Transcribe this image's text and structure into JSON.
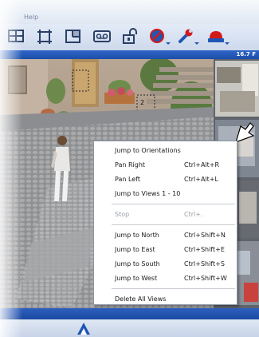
{
  "menubar": {
    "help_label": "Help"
  },
  "statusbar": {
    "fps_text": "16.7 F"
  },
  "toolbar": {
    "buttons": [
      {
        "icon": "grid-layout-icon"
      },
      {
        "icon": "fullscreen-frame-icon"
      },
      {
        "icon": "quad-view-icon"
      },
      {
        "icon": "tape-recorder-icon"
      },
      {
        "icon": "padlock-icon"
      },
      {
        "icon": "no-entry-dropdown-icon"
      },
      {
        "icon": "wrench-dropdown-icon"
      },
      {
        "icon": "alarm-light-dropdown-icon"
      }
    ]
  },
  "context_menu": {
    "group1": [
      {
        "label": "Jump to Orientations",
        "shortcut": ""
      },
      {
        "label": "Pan Right",
        "shortcut": "Ctrl+Alt+R"
      },
      {
        "label": "Pan Left",
        "shortcut": "Ctrl+Alt+L"
      },
      {
        "label": "Jump to Views 1 - 10",
        "shortcut": ""
      }
    ],
    "group2": [
      {
        "label": "Stop",
        "shortcut": "Ctrl+."
      }
    ],
    "group3": [
      {
        "label": "Jump to North",
        "shortcut": "Ctrl+Shift+N"
      },
      {
        "label": "Jump to East",
        "shortcut": "Ctrl+Shift+E"
      },
      {
        "label": "Jump to South",
        "shortcut": "Ctrl+Shift+S"
      },
      {
        "label": "Jump to West",
        "shortcut": "Ctrl+Shift+W"
      }
    ],
    "group4": [
      {
        "label": "Delete All Views",
        "shortcut": ""
      }
    ]
  },
  "scene": {
    "view_marker": "2"
  },
  "colors": {
    "accent_blue": "#1f56b5",
    "toolbar_icon": "#2a3f66",
    "alert_red": "#d21a1a"
  }
}
